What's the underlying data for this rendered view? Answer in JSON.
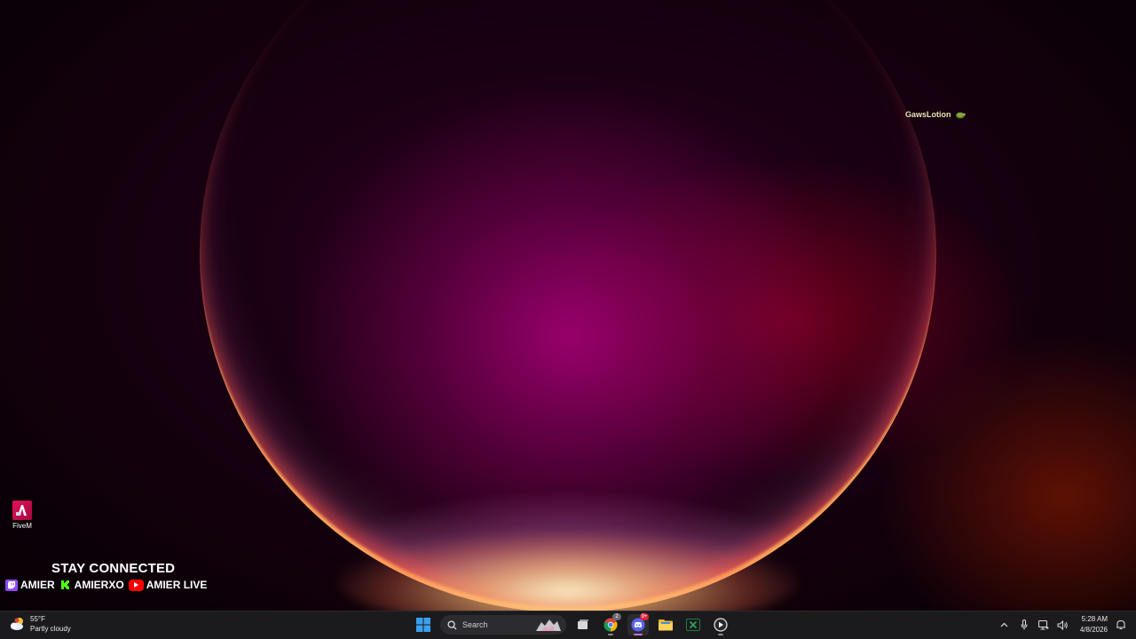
{
  "desktop": {
    "overlay_user": {
      "name": "GawsLotion",
      "icon": "turtle-icon"
    },
    "icons": [
      {
        "label": "FiveM",
        "icon": "fivem-icon"
      }
    ]
  },
  "stream_overlay": {
    "heading": "STAY CONNECTED",
    "socials": [
      {
        "platform_icon": "twitch-icon",
        "name": "AMIER",
        "color": "#9146ff"
      },
      {
        "platform_icon": "kick-icon",
        "name": "AMIERXO",
        "color": "#53fc18"
      },
      {
        "platform_icon": "youtube-icon",
        "name": "AMIER LIVE",
        "color": "#ff0000"
      }
    ]
  },
  "taskbar": {
    "weather": {
      "temperature": "55°F",
      "condition": "Partly cloudy",
      "icon": "partly-cloudy-icon"
    },
    "search": {
      "placeholder": "Search"
    },
    "apps": [
      {
        "name": "start-button",
        "icon": "windows-icon"
      },
      {
        "name": "task-view-button",
        "icon": "task-view-icon"
      },
      {
        "name": "chrome",
        "icon": "chrome-icon",
        "badge": "2"
      },
      {
        "name": "discord",
        "icon": "discord-icon",
        "badge": "9+"
      },
      {
        "name": "file-explorer",
        "icon": "folder-icon"
      },
      {
        "name": "excel",
        "icon": "excel-icon"
      },
      {
        "name": "media-player",
        "icon": "play-icon"
      }
    ],
    "tray": {
      "time": "5:28 AM",
      "date": "4/8/2026"
    }
  }
}
